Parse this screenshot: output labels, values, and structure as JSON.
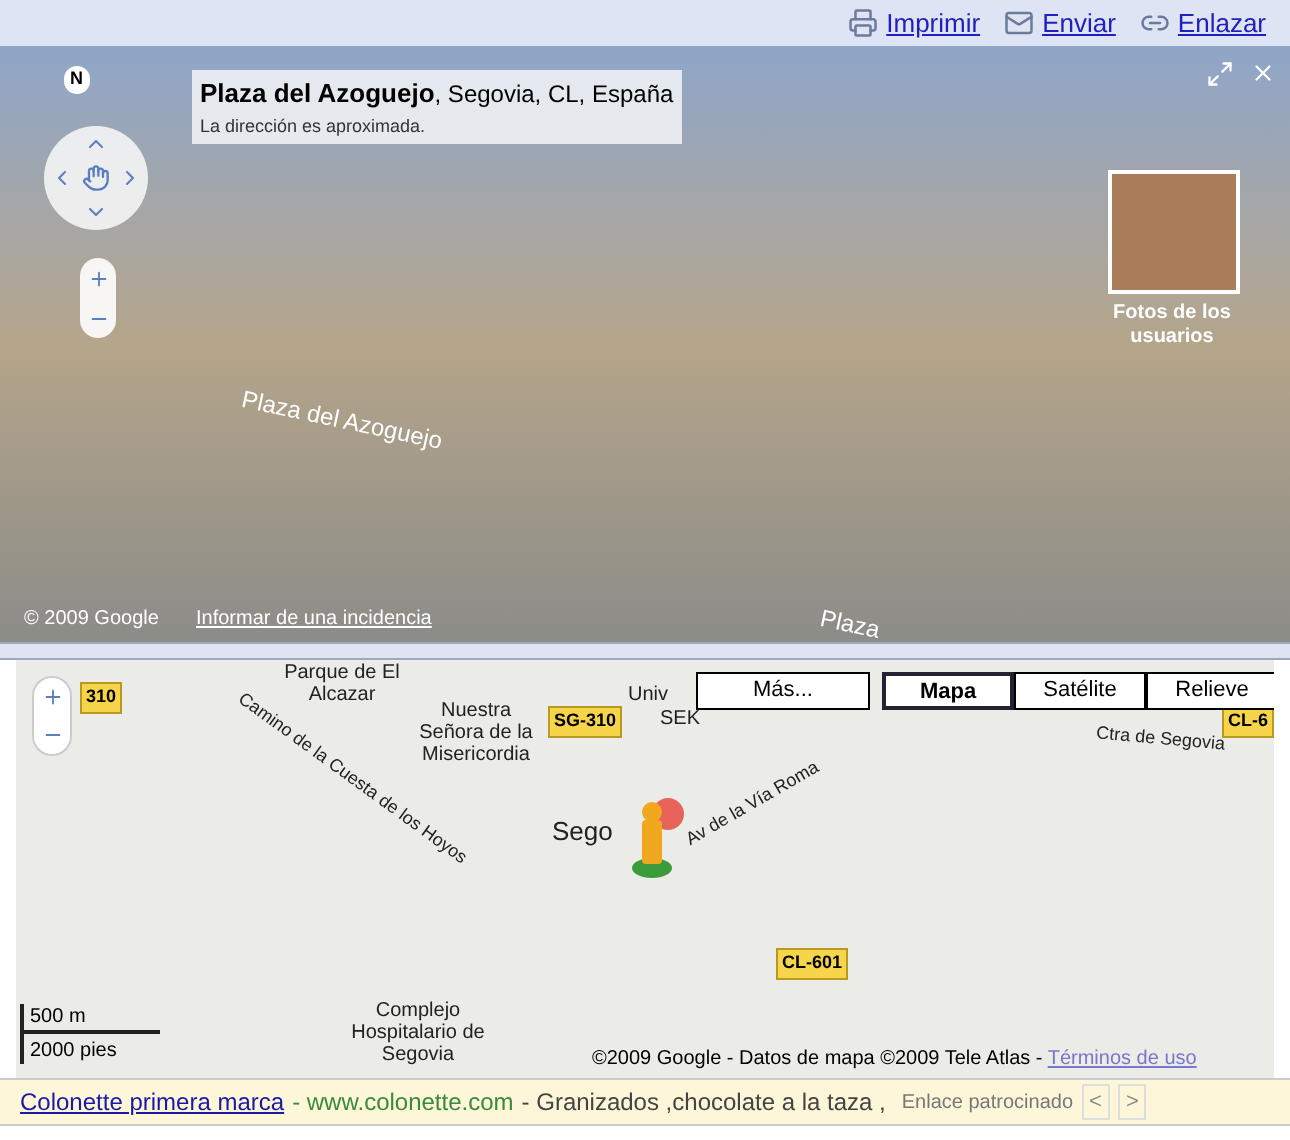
{
  "toolbar": [
    {
      "label": "Imprimir",
      "kind": "print"
    },
    {
      "label": "Enviar",
      "kind": "mail"
    },
    {
      "label": "Enlazar",
      "kind": "link"
    }
  ],
  "street_view": {
    "title": "Plaza del Azoguejo",
    "location": ", Segovia, CL, España",
    "note": "La dirección es aproximada.",
    "compass": "N",
    "user_photos": "Fotos de los usuarios",
    "street_labels": [
      "Plaza del Azoguejo",
      "Plaza"
    ],
    "copyright": "© 2009 Google",
    "report_link": "Informar de una incidencia"
  },
  "map": {
    "more_button": "Más...",
    "map_types": [
      {
        "label": "Mapa",
        "selected": true
      },
      {
        "label": "Satélite",
        "selected": false
      },
      {
        "label": "Relieve",
        "selected": false
      }
    ],
    "labels": [
      {
        "text": "Parque de El Alcazar",
        "kind": "place"
      },
      {
        "text": "Nuestra Señora de la Misericordia",
        "kind": "place"
      },
      {
        "text": "Univ",
        "kind": "place"
      },
      {
        "text": "SEK",
        "kind": "place"
      },
      {
        "text": "Camino de la Cuesta de los Hoyos",
        "kind": "street"
      },
      {
        "text": "Sego",
        "kind": "city"
      },
      {
        "text": "Av de la Vía Roma",
        "kind": "street"
      },
      {
        "text": "Ctra de Segovia",
        "kind": "street"
      },
      {
        "text": "Complejo Hospitalario de Segovia",
        "kind": "place"
      }
    ],
    "shields": [
      "310",
      "SG-310",
      "CL-6",
      "CL-601"
    ],
    "scale": [
      "500 m",
      "2000 pies"
    ],
    "attribution": "©2009 Google - Datos de mapa ©2009 Tele Atlas - ",
    "terms_link": "Términos de uso"
  },
  "ad": {
    "title": "Colonette primera marca",
    "url": "- www.colonette.com",
    "text": "- Granizados ,chocolate a la taza ,",
    "sponsored": "Enlace patrocinado",
    "prev": "<",
    "next": ">",
    "prev_disabled": true,
    "next_disabled": true
  }
}
